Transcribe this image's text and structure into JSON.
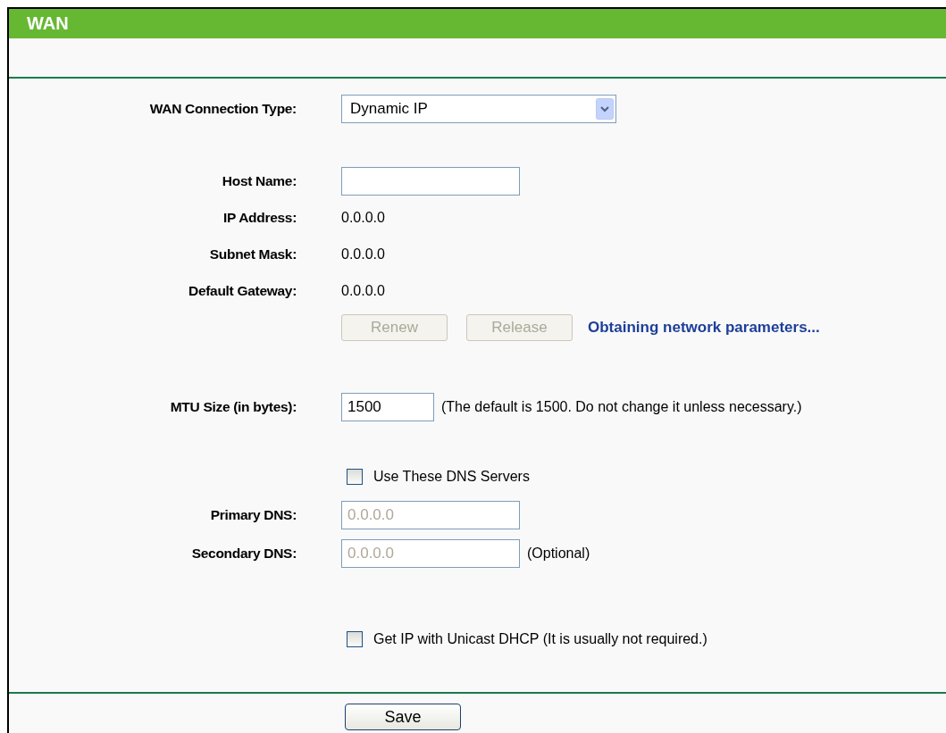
{
  "header": {
    "title": "WAN"
  },
  "sections": [
    [
      {
        "kind": "select",
        "label": "WAN Connection Type:",
        "value": "Dynamic IP"
      }
    ],
    [
      {
        "kind": "input",
        "label": "Host Name:"
      },
      {
        "kind": "static",
        "label": "IP Address:",
        "value": "0.0.0.0"
      },
      {
        "kind": "static",
        "label": "Subnet Mask:",
        "value": "0.0.0.0"
      },
      {
        "kind": "static",
        "label": "Default Gateway:",
        "value": "0.0.0.0"
      },
      {
        "kind": "buttons",
        "buttons": [
          {
            "label": "Renew",
            "disabled": true
          },
          {
            "label": "Release",
            "disabled": true
          }
        ],
        "status": "Obtaining network parameters..."
      }
    ],
    [
      {
        "kind": "number",
        "label": "MTU Size (in bytes):",
        "value": "1500",
        "disabled": false,
        "note": "(The default is 1500. Do not change it unless necessary.)"
      }
    ],
    [
      {
        "kind": "checkbox",
        "label": "Use These DNS Servers",
        "checked": false
      },
      {
        "kind": "input",
        "label": "Primary DNS:",
        "value": "0.0.0.0",
        "disabled": true
      },
      {
        "kind": "input",
        "label": "Secondary DNS:",
        "value": "0.0.0.0",
        "disabled": true,
        "note": "(Optional)"
      }
    ],
    [
      {
        "kind": "checkbox",
        "label": "Get IP with Unicast DHCP (It is usually not required.)",
        "checked": false
      }
    ]
  ],
  "footer": {
    "buttons": [
      {
        "label": "Save",
        "disabled": false
      }
    ]
  }
}
